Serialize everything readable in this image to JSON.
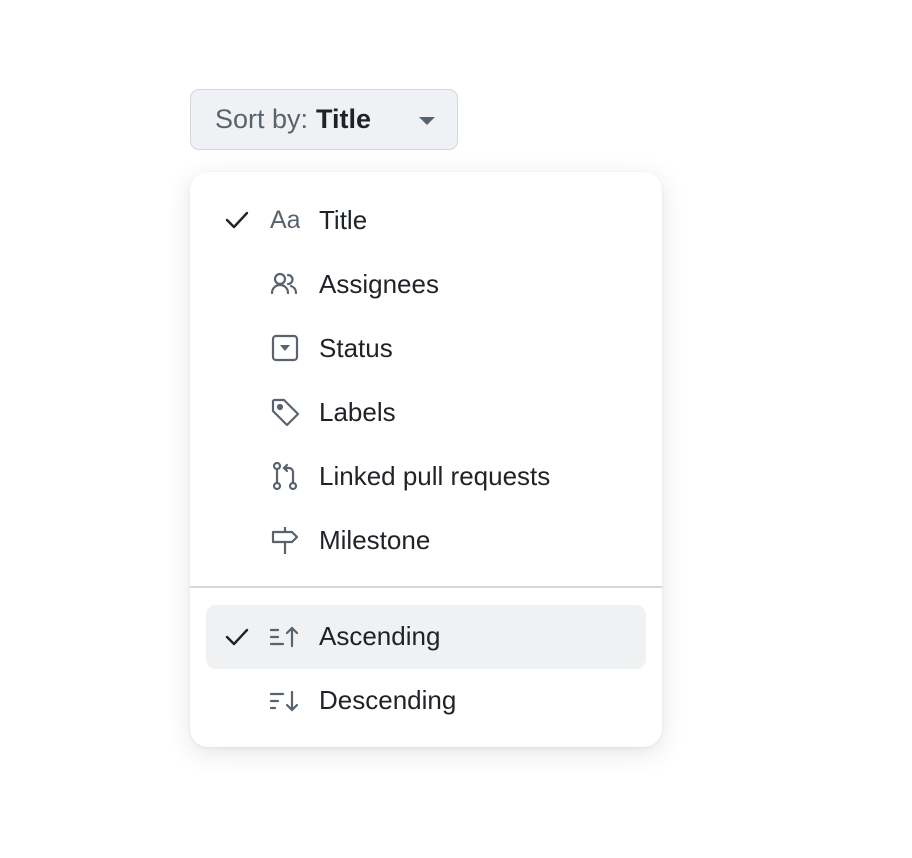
{
  "sort_button": {
    "label": "Sort by:",
    "value": "Title"
  },
  "menu": {
    "fields": [
      {
        "label": "Title",
        "icon": "typography-icon",
        "checked": true
      },
      {
        "label": "Assignees",
        "icon": "people-icon",
        "checked": false
      },
      {
        "label": "Status",
        "icon": "single-select-icon",
        "checked": false
      },
      {
        "label": "Labels",
        "icon": "tag-icon",
        "checked": false
      },
      {
        "label": "Linked pull requests",
        "icon": "git-pull-request-icon",
        "checked": false
      },
      {
        "label": "Milestone",
        "icon": "milestone-icon",
        "checked": false
      }
    ],
    "directions": [
      {
        "label": "Ascending",
        "icon": "sort-asc-icon",
        "checked": true
      },
      {
        "label": "Descending",
        "icon": "sort-desc-icon",
        "checked": false
      }
    ]
  },
  "colors": {
    "icon": "#59636e",
    "text": "#1f2328",
    "highlight": "#eff1f3"
  }
}
